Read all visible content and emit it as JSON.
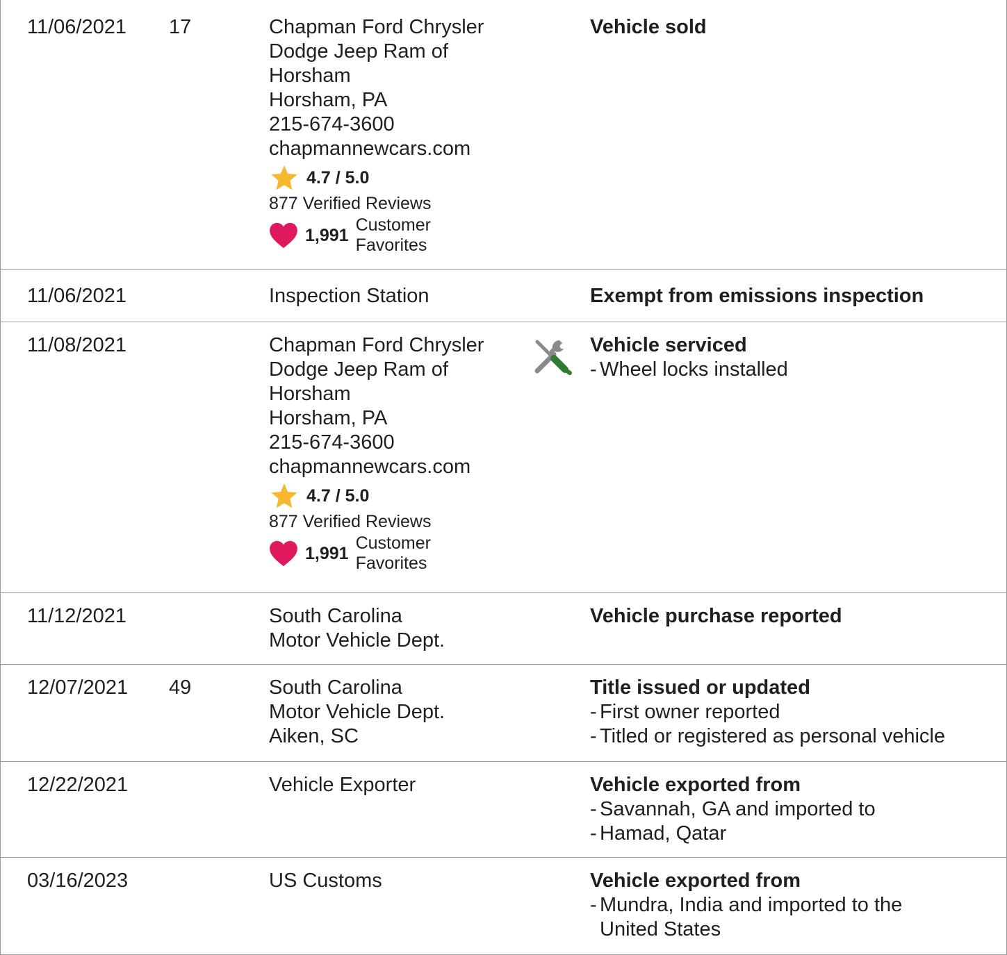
{
  "rows": [
    {
      "date": "11/06/2021",
      "mileage": "17",
      "source": [
        "Chapman Ford Chrysler",
        "Dodge Jeep Ram of",
        "Horsham",
        "Horsham, PA",
        "215-674-3600",
        "chapmannewcars.com"
      ],
      "rating": "4.7 / 5.0",
      "reviews": "877 Verified Reviews",
      "favorites_count": "1,991",
      "favorites_label": [
        "Customer",
        "Favorites"
      ],
      "title": "Vehicle sold",
      "items": []
    },
    {
      "date": "11/06/2021",
      "mileage": "",
      "source": [
        "Inspection Station"
      ],
      "title": "Exempt from emissions inspection",
      "items": []
    },
    {
      "date": "11/08/2021",
      "mileage": "",
      "source": [
        "Chapman Ford Chrysler",
        "Dodge Jeep Ram of",
        "Horsham",
        "Horsham, PA",
        "215-674-3600",
        "chapmannewcars.com"
      ],
      "rating": "4.7 / 5.0",
      "reviews": "877 Verified Reviews",
      "favorites_count": "1,991",
      "favorites_label": [
        "Customer",
        "Favorites"
      ],
      "icon": "service-tools-icon",
      "title": "Vehicle serviced",
      "items": [
        "Wheel locks installed"
      ]
    },
    {
      "date": "11/12/2021",
      "mileage": "",
      "source": [
        "South Carolina",
        "Motor Vehicle Dept."
      ],
      "title": "Vehicle purchase reported",
      "items": []
    },
    {
      "date": "12/07/2021",
      "mileage": "49",
      "source": [
        "South Carolina",
        "Motor Vehicle Dept.",
        "Aiken, SC"
      ],
      "title": "Title issued or updated",
      "items": [
        "First owner reported",
        "Titled or registered as personal vehicle"
      ]
    },
    {
      "date": "12/22/2021",
      "mileage": "",
      "source": [
        "Vehicle Exporter"
      ],
      "title": "Vehicle exported from",
      "items": [
        "Savannah, GA and imported to",
        "Hamad, Qatar"
      ]
    },
    {
      "date": "03/16/2023",
      "mileage": "",
      "source": [
        "US Customs"
      ],
      "title": "Vehicle exported from",
      "items": [
        "Mundra, India and imported to the United States"
      ]
    }
  ],
  "colors": {
    "star": "#f5b82e",
    "heart": "#e0195f",
    "tool_gray": "#8a8a8a",
    "tool_green": "#2e7d32",
    "border": "#9a9a9a"
  }
}
